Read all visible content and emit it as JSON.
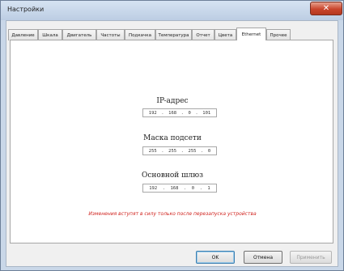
{
  "window": {
    "title": "Настройки",
    "close_glyph": "✕"
  },
  "tabs": [
    {
      "label": "Давление",
      "active": false
    },
    {
      "label": "Шкала",
      "active": false
    },
    {
      "label": "Двигатель",
      "active": false
    },
    {
      "label": "Частоты",
      "active": false
    },
    {
      "label": "Подкачка",
      "active": false
    },
    {
      "label": "Температура",
      "active": false
    },
    {
      "label": "Отчет",
      "active": false
    },
    {
      "label": "Цвета",
      "active": false
    },
    {
      "label": "Ethernet",
      "active": true
    },
    {
      "label": "Прочее",
      "active": false
    }
  ],
  "ethernet": {
    "ip": {
      "label": "IP-адрес",
      "octets": [
        "192",
        "168",
        "0",
        "101"
      ]
    },
    "mask": {
      "label": "Маска подсети",
      "octets": [
        "255",
        "255",
        "255",
        "0"
      ]
    },
    "gateway": {
      "label": "Основной шлюз",
      "octets": [
        "192",
        "168",
        "0",
        "1"
      ]
    },
    "warning": "Изменения вступят в силу только после перезапуска устройства"
  },
  "buttons": {
    "ok": "OK",
    "cancel": "Отмена",
    "apply": "Применить"
  }
}
